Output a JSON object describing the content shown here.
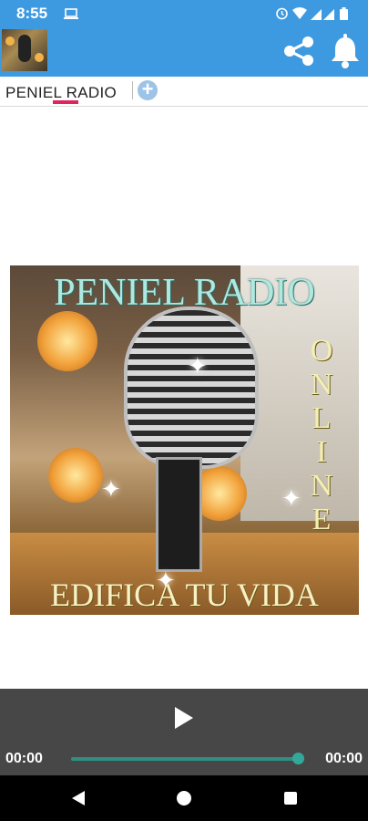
{
  "status_bar": {
    "time": "8:55"
  },
  "app_bar": {
    "tab_label": "PENIEL RADIO"
  },
  "cover": {
    "title": "PENIEL RADIO",
    "online_letters": [
      "O",
      "N",
      "L",
      "I",
      "N",
      "E"
    ],
    "slogan": "EDIFICA TU VIDA"
  },
  "player": {
    "elapsed": "00:00",
    "duration": "00:00",
    "progress": 1.0
  },
  "colors": {
    "app_bar": "#3e9ae0",
    "player_bg": "#474747",
    "seek": "#33a89a",
    "tab_indicator": "#e0245e"
  },
  "icons": [
    "laptop-icon",
    "alarm-icon",
    "wifi-icon",
    "signal-icon",
    "battery-icon",
    "share-icon",
    "bell-icon",
    "add-icon",
    "play-icon",
    "back-icon",
    "home-icon",
    "recents-icon"
  ]
}
